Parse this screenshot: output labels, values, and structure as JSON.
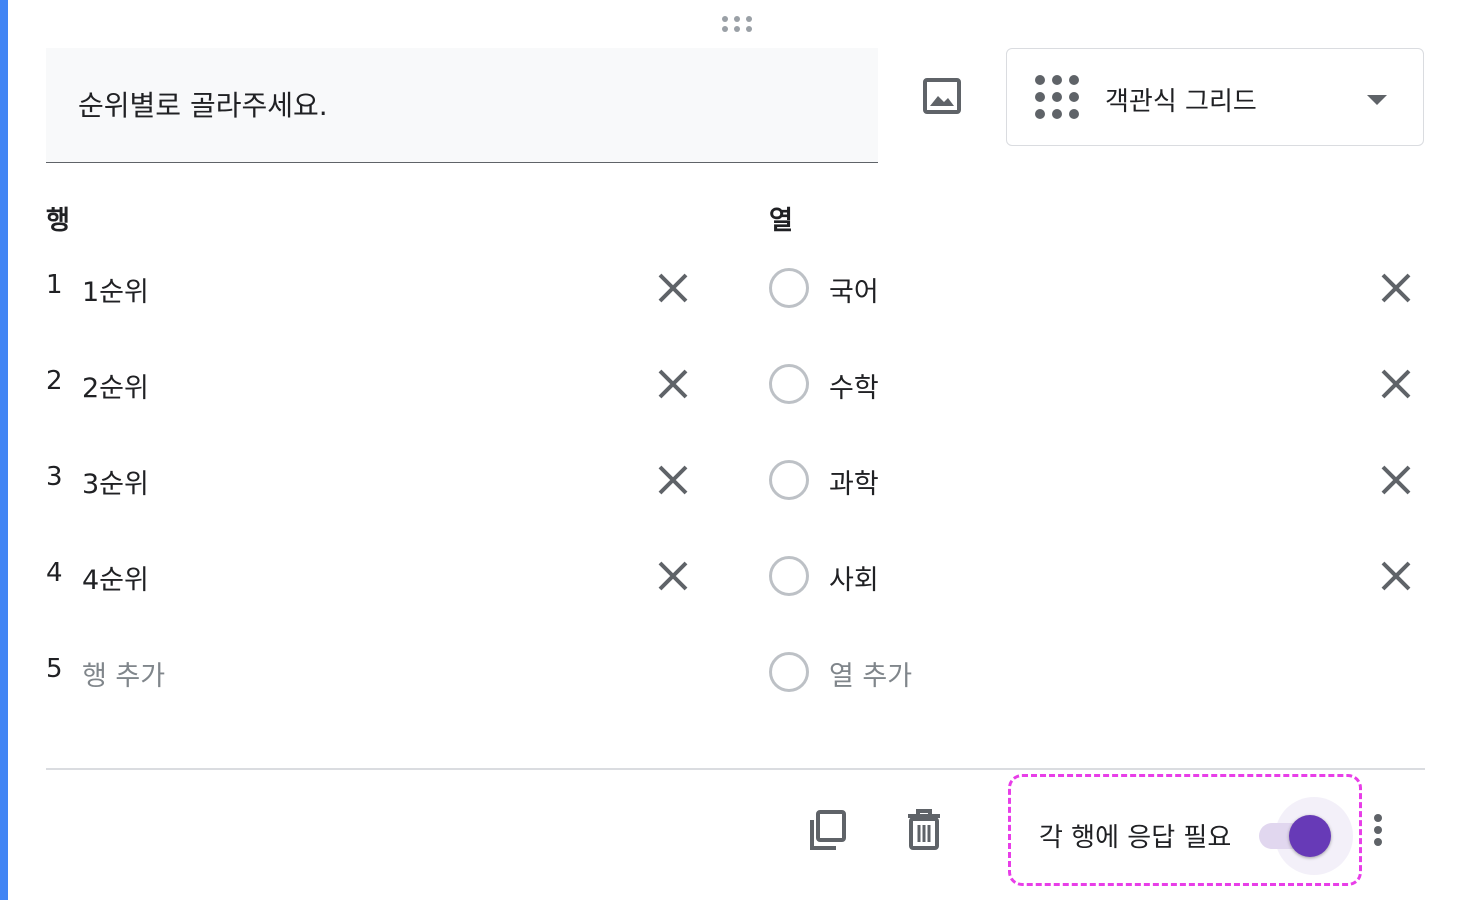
{
  "question": {
    "title": "순위별로 골라주세요."
  },
  "type_select": {
    "label": "객관식 그리드",
    "icon": "grid-dots-icon"
  },
  "rows": {
    "header": "행",
    "items": [
      {
        "num": "1",
        "label": "1순위"
      },
      {
        "num": "2",
        "label": "2순위"
      },
      {
        "num": "3",
        "label": "3순위"
      },
      {
        "num": "4",
        "label": "4순위"
      }
    ],
    "add": {
      "num": "5",
      "label": "행 추가"
    }
  },
  "columns": {
    "header": "열",
    "items": [
      {
        "label": "국어"
      },
      {
        "label": "수학"
      },
      {
        "label": "과학"
      },
      {
        "label": "사회"
      }
    ],
    "add": {
      "label": "열 추가"
    }
  },
  "footer": {
    "required_label": "각 행에 응답 필요",
    "required_on": true
  },
  "colors": {
    "accent": "#4285f4",
    "toggle": "#673ab7",
    "highlight": "#e83ee8",
    "icon": "#5f6368"
  }
}
